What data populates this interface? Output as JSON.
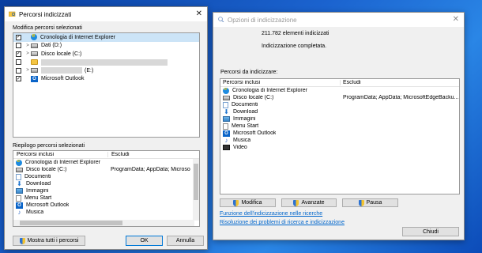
{
  "desktop": {
    "accent": "#1b63cf"
  },
  "left_window": {
    "title": "Percorsi indicizzati",
    "modify_label": "Modifica percorsi selezionati",
    "tree": [
      {
        "label": "Cronologia di Internet Explorer",
        "checked": true,
        "expander": "",
        "icon": "ie-icon",
        "selected": true
      },
      {
        "label": "Dati (D:)",
        "checked": false,
        "expander": ">",
        "icon": "drive-icon"
      },
      {
        "label": "Disco locale (C:)",
        "checked": true,
        "expander": ">",
        "icon": "drive-icon"
      },
      {
        "label": "",
        "checked": false,
        "expander": "",
        "icon": "folder-icon",
        "redacted": true
      },
      {
        "label": "(E:)",
        "checked": false,
        "expander": ">",
        "icon": "drive-icon",
        "redacted": true
      },
      {
        "label": "Microsoft Outlook",
        "checked": true,
        "expander": "",
        "icon": "outlook-icon"
      }
    ],
    "summary_label": "Riepilogo percorsi selezionati",
    "summary_headers": {
      "included": "Percorsi inclusi",
      "excluded": "Escludi"
    },
    "summary_rows": [
      {
        "included": "Cronologia di Internet Explorer",
        "excluded": "",
        "icon": "ie-icon"
      },
      {
        "included": "Disco locale (C:)",
        "excluded": "ProgramData; AppData; Microso",
        "icon": "drive-icon"
      },
      {
        "included": "Documenti",
        "excluded": "",
        "icon": "docs-icon"
      },
      {
        "included": "Download",
        "excluded": "",
        "icon": "download-icon"
      },
      {
        "included": "Immagini",
        "excluded": "",
        "icon": "images-icon"
      },
      {
        "included": "Menu Start",
        "excluded": "",
        "icon": "menu-icon"
      },
      {
        "included": "Microsoft Outlook",
        "excluded": "",
        "icon": "outlook-icon"
      },
      {
        "included": "Musica",
        "excluded": "",
        "icon": "music-icon"
      }
    ],
    "show_all_button": "Mostra tutti i percorsi",
    "ok_button": "OK",
    "cancel_button": "Annulla"
  },
  "right_window": {
    "title": "Opzioni di indicizzazione",
    "items_count": "211.782 elementi indicizzati",
    "status": "Indicizzazione completata.",
    "locations_label": "Percorsi da indicizzare:",
    "headers": {
      "included": "Percorsi inclusi",
      "excluded": "Escludi"
    },
    "rows": [
      {
        "included": "Cronologia di Internet Explorer",
        "excluded": "",
        "icon": "ie-icon"
      },
      {
        "included": "Disco locale (C:)",
        "excluded": "ProgramData; AppData; MicrosoftEdgeBacku...",
        "icon": "drive-icon"
      },
      {
        "included": "Documenti",
        "excluded": "",
        "icon": "docs-icon"
      },
      {
        "included": "Download",
        "excluded": "",
        "icon": "download-icon"
      },
      {
        "included": "Immagini",
        "excluded": "",
        "icon": "images-icon"
      },
      {
        "included": "Menu Start",
        "excluded": "",
        "icon": "menu-icon"
      },
      {
        "included": "Microsoft Outlook",
        "excluded": "",
        "icon": "outlook-icon"
      },
      {
        "included": "Musica",
        "excluded": "",
        "icon": "music-icon"
      },
      {
        "included": "Video",
        "excluded": "",
        "icon": "video-icon"
      }
    ],
    "modify_button": "Modifica",
    "advanced_button": "Avanzate",
    "pause_button": "Pausa",
    "link_how": "Funzione dell'indicizzazione nelle ricerche",
    "link_troubleshoot": "Risoluzione dei problemi di ricerca e indicizzazione",
    "close_button": "Chiudi"
  }
}
